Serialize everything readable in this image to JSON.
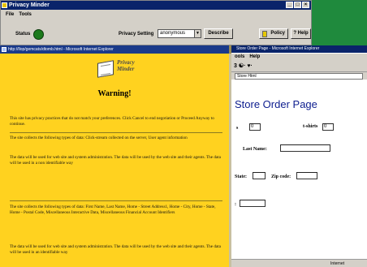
{
  "pm": {
    "title": "Privacy Minder",
    "menu": [
      "File",
      "Tools"
    ],
    "status_label": "Status",
    "privacy_setting_label": "Privacy Setting",
    "privacy_setting_value": "anonymous",
    "describe_label": "Describe",
    "policy_label": "Policy",
    "help_label": "? Help",
    "status_color": "#1c7a1c"
  },
  "ie": {
    "title": "http://llop/gemcats/dtomb.html - Microsoft Internet Explorer",
    "logo_line1": "Privacy",
    "logo_line2": "Minder",
    "warning": "Warning!",
    "p1": "This site has privacy practices that do not match your preferences. Click Cancel to end negotiation or Proceed Anyway to continue.",
    "p2": "The site collects the following types of data: Click-stream collected on the server, User agent information",
    "p3": "The data will be used for web site and system administration. The data will be used by the web site and their agents. The data will be used in a non identifiable way",
    "p4": "The site collects the following types of data: First Name, Last Name, Home - Street Address1, Home - City, Home - State, Home - Postal Code, Miscellaneous Interactive Data, Miscellaneous Financial Account Identifiers",
    "p5": "The data will be used for web site and system administration. The data will be used by the web site and their agents. The data will be used in an identifiable way"
  },
  "rb": {
    "title": "Store Order Page - Microsoft Internet Explorer",
    "menu": [
      "ools",
      "Help"
    ],
    "tools": "3 ☯· ♥·",
    "address": "Store Html",
    "page_title": "Store Order Page",
    "qty1": "0",
    "qty2_label": "t-shirts",
    "qty2": "0",
    "last_name_label": "Last Name:",
    "state_label": "State:",
    "zip_label": "Zip code:",
    "status_zone": "Internet"
  },
  "colors": {
    "accent_green": "#1f8a3d",
    "warning_yellow": "#ffd21f",
    "title_blue": "#0a246a",
    "store_title": "#102090"
  },
  "icons": {
    "status": "green-status-icon",
    "policy": "policy-document-icon",
    "logo": "book-icon"
  }
}
